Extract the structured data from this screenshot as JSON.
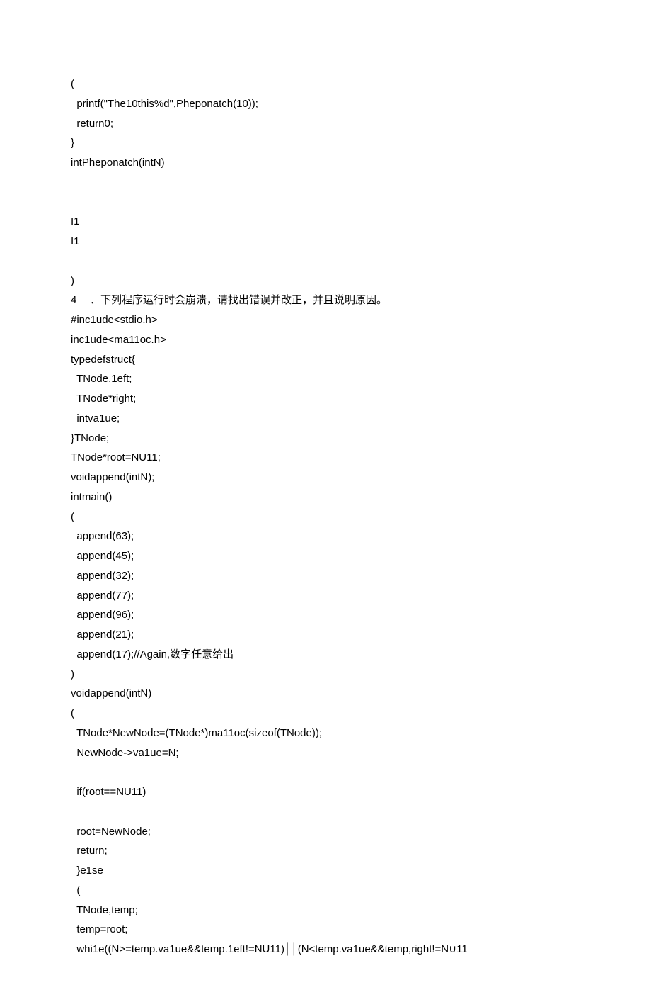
{
  "lines": {
    "l00": "(",
    "l01": "  printf(\"The10this%d\",Pheponatch(10));",
    "l02": "  return0;",
    "l03": "}",
    "l04": "intPheponatch(intN)",
    "l05": "I1",
    "l06": "I1",
    "l07": ")",
    "q4_num": "4",
    "q4_text": "．下列程序运行时会崩溃，请找出错误并改正，并且说明原因。",
    "l09": "#inc1ude<stdio.h>",
    "l10": "inc1ude<ma11oc.h>",
    "l11": "typedefstruct{",
    "l12": "  TNode,1eft;",
    "l13": "  TNode*right;",
    "l14": "  intva1ue;",
    "l15": "}TNode;",
    "l16": "TNode*root=NU11;",
    "l17": "voidappend(intN);",
    "l18": "intmain()",
    "l19": "(",
    "l20": "  append(63);",
    "l21": "  append(45);",
    "l22": "  append(32);",
    "l23": "  append(77);",
    "l24": "  append(96);",
    "l25": "  append(21);",
    "l26": "  append(17);//Again,数字任意给出",
    "l27": ")",
    "l28": "voidappend(intN)",
    "l29": "(",
    "l30": "  TNode*NewNode=(TNode*)ma11oc(sizeof(TNode));",
    "l31": "  NewNode->va1ue=N;",
    "l32": "  if(root==NU11)",
    "l33": "  root=NewNode;",
    "l34": "  return;",
    "l35": "  }e1se",
    "l36": "  (",
    "l37": "  TNode,temp;",
    "l38": "  temp=root;",
    "l39": "  whi1e((N>=temp.va1ue&&temp.1eft!=NU11)││(N<temp.va1ue&&temp,right!=N∪11"
  }
}
